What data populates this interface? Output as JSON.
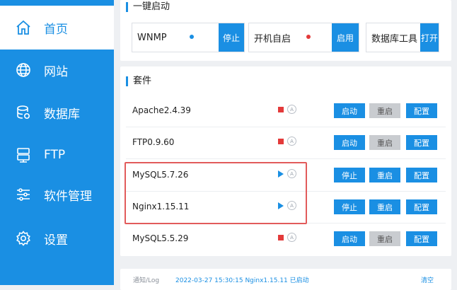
{
  "sidebar": {
    "items": [
      {
        "label": "首页",
        "icon": "home-icon",
        "active": true
      },
      {
        "label": "网站",
        "icon": "globe-icon",
        "active": false
      },
      {
        "label": "数据库",
        "icon": "database-icon",
        "active": false
      },
      {
        "label": "FTP",
        "icon": "server-icon",
        "active": false
      },
      {
        "label": "软件管理",
        "icon": "sliders-icon",
        "active": false
      },
      {
        "label": "设置",
        "icon": "gear-icon",
        "active": false
      }
    ]
  },
  "quick_start": {
    "title": "一键启动",
    "items": [
      {
        "label": "WNMP",
        "status_color": "#1a8fe3",
        "button": "停止"
      },
      {
        "label": "开机自启",
        "status_color": "#e33a3a",
        "button": "启用"
      },
      {
        "label": "数据库工具",
        "status_color": "",
        "button": "打开"
      }
    ]
  },
  "suite": {
    "title": "套件",
    "rows": [
      {
        "name": "Apache2.4.39",
        "status": "stopped",
        "auto": "A",
        "b1": "启动",
        "b2": "重启",
        "b2_disabled": true,
        "b3": "配置"
      },
      {
        "name": "FTP0.9.60",
        "status": "stopped",
        "auto": "A",
        "b1": "启动",
        "b2": "重启",
        "b2_disabled": true,
        "b3": "配置"
      },
      {
        "name": "MySQL5.7.26",
        "status": "running",
        "auto": "A",
        "b1": "停止",
        "b2": "重启",
        "b2_disabled": false,
        "b3": "配置"
      },
      {
        "name": "Nginx1.15.11",
        "status": "running",
        "auto": "A",
        "b1": "停止",
        "b2": "重启",
        "b2_disabled": false,
        "b3": "配置"
      },
      {
        "name": "MySQL5.5.29",
        "status": "stopped",
        "auto": "A",
        "b1": "启动",
        "b2": "重启",
        "b2_disabled": true,
        "b3": "配置"
      }
    ]
  },
  "log": {
    "label": "通知/Log",
    "message": "2022-03-27 15:30:15 Nginx1.15.11 已启动",
    "link": "清空"
  },
  "colors": {
    "accent": "#1a8fe3",
    "stop": "#e33a3a",
    "highlight": "#e25b5b"
  }
}
